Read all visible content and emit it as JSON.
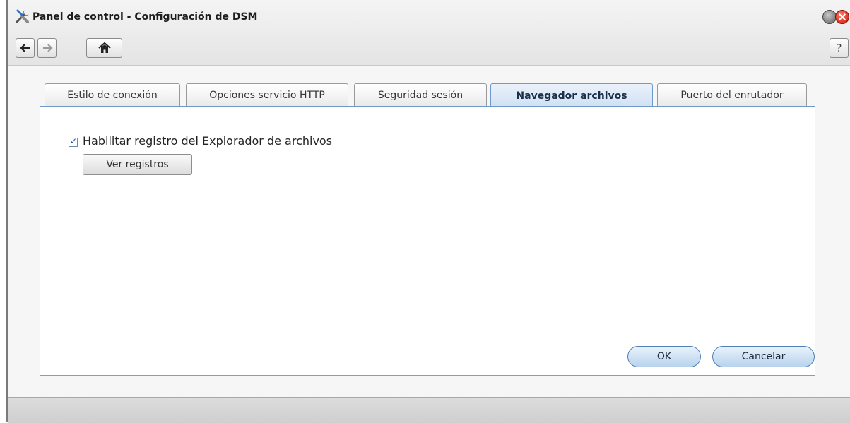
{
  "window": {
    "title": "Panel de control - Configuración de DSM"
  },
  "toolbar": {
    "back_icon": "arrow-left-icon",
    "forward_icon": "arrow-right-icon",
    "home_icon": "home-icon",
    "help_label": "?"
  },
  "tabs": [
    {
      "label": "Estilo de conexión",
      "active": false
    },
    {
      "label": "Opciones servicio HTTP",
      "active": false
    },
    {
      "label": "Seguridad sesión",
      "active": false
    },
    {
      "label": "Navegador archivos",
      "active": true
    },
    {
      "label": "Puerto del enrutador",
      "active": false
    }
  ],
  "content": {
    "checkbox_label": "Habilitar registro del Explorador de archivos",
    "checkbox_checked": true,
    "view_logs_label": "Ver registros"
  },
  "footer": {
    "ok_label": "OK",
    "cancel_label": "Cancelar"
  },
  "colors": {
    "accent": "#6d9acb",
    "close": "#d2231a"
  }
}
